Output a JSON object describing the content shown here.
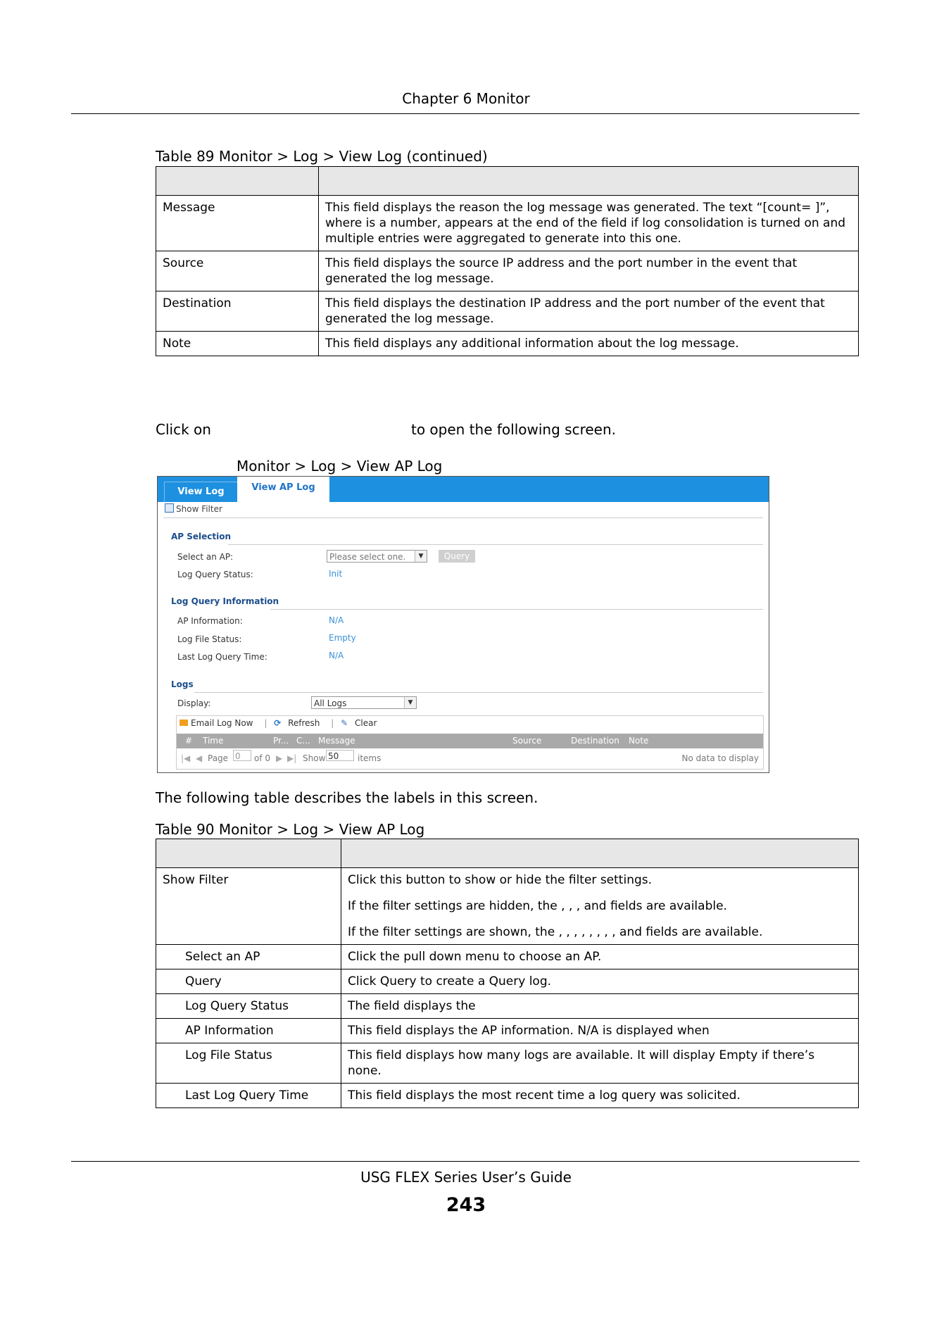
{
  "header": {
    "chapter": "Chapter 6 Monitor"
  },
  "table89": {
    "caption": "Table 89   Monitor > Log > View Log (continued)",
    "rows": [
      {
        "label": "Message",
        "text": "This field displays the reason the log message was generated. The text “[count= ]”, where    is a number, appears at the end of the                  field if log consolidation is turned on and multiple entries were aggregated to generate into this one."
      },
      {
        "label": "Source",
        "text": "This field displays the source IP address and the port number in the event that generated the log message."
      },
      {
        "label": "Destination",
        "text": "This field displays the destination IP address and the port number of the event that generated the log message."
      },
      {
        "label": "Note",
        "text": "This field displays any additional information about the log message."
      }
    ]
  },
  "intro": {
    "click_on": "Click on",
    "open_text": "to open the following screen."
  },
  "figure_caption": "Monitor > Log > View AP Log",
  "screen": {
    "tabs": {
      "view_log": "View Log",
      "view_ap_log": "View AP Log"
    },
    "show_filter": "Show Filter",
    "ap_selection": {
      "title": "AP Selection",
      "select_label": "Select an AP:",
      "select_value": "Please select one.",
      "query_button": "Query",
      "status_label": "Log Query Status:",
      "status_value": "Init"
    },
    "query_info": {
      "title": "Log Query Information",
      "ap_info_label": "AP Information:",
      "ap_info_value": "N/A",
      "file_status_label": "Log File Status:",
      "file_status_value": "Empty",
      "last_time_label": "Last Log Query Time:",
      "last_time_value": "N/A"
    },
    "logs": {
      "title": "Logs",
      "display_label": "Display:",
      "display_value": "All Logs",
      "toolbar": {
        "email": "Email Log Now",
        "refresh": "Refresh",
        "clear": "Clear"
      },
      "columns": {
        "num": "#",
        "time": "Time",
        "pri": "Pr...",
        "cat": "C...",
        "message": "Message",
        "source": "Source",
        "destination": "Destination",
        "note": "Note"
      },
      "pager": {
        "page": "Page",
        "page_value": "0",
        "of": "of 0",
        "show": "Show",
        "show_value": "50",
        "items": "items",
        "status": "No data to display"
      }
    }
  },
  "describes": "The following table describes the labels in this screen.",
  "table90": {
    "caption": "Table 90   Monitor > Log > View AP Log",
    "show_filter": {
      "label": "Show Filter",
      "p1": "Click this button to show or hide the filter settings.",
      "p2": "If the filter settings are hidden, the            ,                          ,              , and             fields are available.",
      "p3": "If the filter settings are shown, the            ,            ,                          ,                                ,                               ,            ,              ,              , and              fields are available."
    },
    "rows": [
      {
        "label": "Select an AP",
        "text": "Click the pull down menu to choose an AP."
      },
      {
        "label": "Query",
        "text": "Click Query to create a Query log."
      },
      {
        "label": "Log Query Status",
        "text": "The field displays the"
      },
      {
        "label": "AP Information",
        "text": "This field displays the AP information. N/A is displayed when"
      },
      {
        "label": "Log File Status",
        "text": "This field displays how many logs are available. It will display Empty if there’s none."
      },
      {
        "label": "Last Log Query Time",
        "text": "This field displays the most recent time a log query was solicited."
      }
    ]
  },
  "footer": {
    "guide": "USG FLEX Series User’s Guide",
    "page_number": "243"
  }
}
